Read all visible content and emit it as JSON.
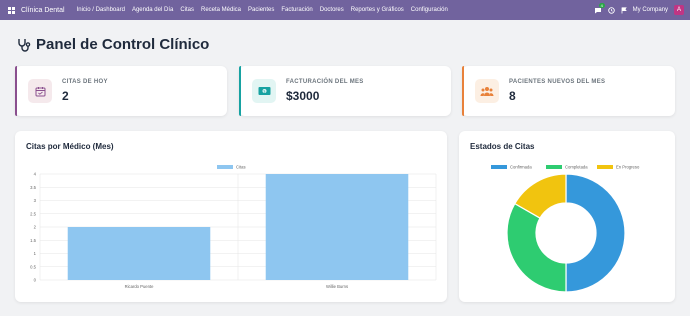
{
  "navbar": {
    "brand": "Clínica Dental",
    "menu": [
      "Inicio / Dashboard",
      "Agenda del Día",
      "Citas",
      "Receta Médica",
      "Pacientes",
      "Facturación",
      "Doctores",
      "Reportes y Gráficos",
      "Configuración"
    ],
    "chat_badge": "4",
    "company": "My Company",
    "avatar_initial": "A",
    "color": "#71639e"
  },
  "page": {
    "title": "Panel de Control Clínico",
    "title_icon": "stethoscope-icon"
  },
  "kpis": [
    {
      "label": "CITAS DE HOY",
      "value": "2",
      "icon": "calendar-check-icon",
      "accent": "#8a4f8e",
      "icon_bg": "#f5e9ec",
      "icon_color": "#8a4f8e"
    },
    {
      "label": "FACTURACIÓN DEL MES",
      "value": "$3000",
      "icon": "money-bill-icon",
      "accent": "#17a2a2",
      "icon_bg": "#e2f5f3",
      "icon_color": "#17a2a2"
    },
    {
      "label": "PACIENTES NUEVOS DEL MES",
      "value": "8",
      "icon": "users-icon",
      "accent": "#e8813a",
      "icon_bg": "#fcefe3",
      "icon_color": "#e8813a"
    }
  ],
  "chart_data": [
    {
      "type": "bar",
      "title": "Citas por Médico (Mes)",
      "categories": [
        "Ricardo Puente",
        "Willie Burns"
      ],
      "series": [
        {
          "name": "Citas",
          "values": [
            2,
            4
          ],
          "color": "#8ec6f0"
        }
      ],
      "ylim": [
        0,
        4
      ],
      "yticks": [
        "4",
        "3.5",
        "3",
        "2.5",
        "2",
        "1.5",
        "1",
        "0.5",
        "0"
      ],
      "grid": true,
      "legend": "top-center"
    },
    {
      "type": "pie",
      "title": "Estados de Citas",
      "labels": [
        "Confirmada",
        "Completada",
        "En Progreso"
      ],
      "values": [
        50,
        33.3,
        16.7
      ],
      "colors": [
        "#3598db",
        "#2ecc71",
        "#f1c40f"
      ],
      "donut": true,
      "legend": "top-center"
    }
  ]
}
